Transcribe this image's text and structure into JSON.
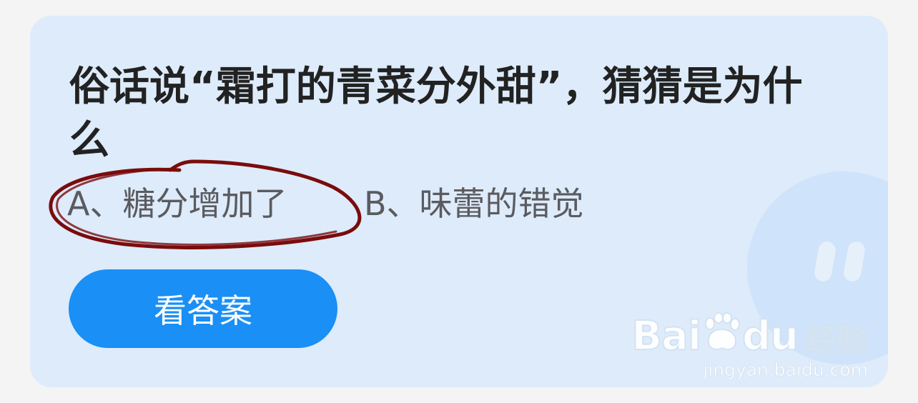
{
  "question": {
    "text": "俗话说“霜打的青菜分外甜”，猜猜是为什么"
  },
  "options": [
    {
      "label": "A、糖分增加了",
      "circled": true
    },
    {
      "label": "B、味蕾的错觉",
      "circled": false
    }
  ],
  "answer_button": {
    "label": "看答案"
  },
  "watermark": {
    "brand_left": "Bai",
    "brand_right": "du",
    "product": "经验",
    "url": "jingyan.baidu.com"
  },
  "colors": {
    "card_background": "#ddebfb",
    "button": "#1a8ff5",
    "annotation_circle": "#7a0c0c",
    "question_text": "#222222",
    "option_text": "#5b5b5f"
  },
  "icons": {
    "annotation": "hand-drawn-circle",
    "mascot": "round-face-mascot",
    "paw": "baidu-paw-icon"
  }
}
